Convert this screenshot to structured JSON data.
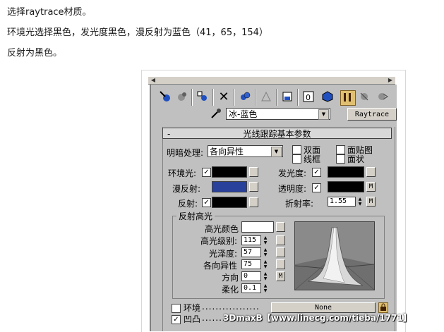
{
  "intro": {
    "line1": "选择raytrace材质。",
    "line2": "环境光选择黑色，发光度黑色，漫反射为蓝色（41，65，154）",
    "line3": "反射为黑色。"
  },
  "material": {
    "name": "冰-蓝色",
    "type_button": "Raytrace"
  },
  "rollout": {
    "toggle": "-",
    "title": "光线跟踪基本参数",
    "shading_label": "明暗处理:",
    "shading_value": "各向异性",
    "two_sided": "双面",
    "wire": "线框",
    "face_map": "面贴图",
    "faceted": "面状",
    "ambient_label": "环境光:",
    "ambient_checked": "✓",
    "diffuse_label": "漫反射:",
    "reflect_label": "反射:",
    "reflect_checked": "✓",
    "luminosity_label": "发光度:",
    "luminosity_checked": "✓",
    "transparency_label": "透明度:",
    "transparency_checked": "✓",
    "ior_label": "折射率:",
    "ior_value": "1.55",
    "map_button": "M",
    "colors": {
      "ambient": "#000000",
      "diffuse": "#29419a",
      "reflect": "#000000",
      "luminosity": "#000000",
      "transparency": "#000000",
      "specular": "#ffffff"
    }
  },
  "specular": {
    "group_title": "反射高光",
    "color_label": "高光颜色",
    "level_label": "高光级别:",
    "level_value": "115",
    "gloss_label": "光泽度:",
    "gloss_value": "57",
    "aniso_label": "各向异性",
    "aniso_value": "75",
    "orient_label": "方向",
    "orient_value": "0",
    "soften_label": "柔化",
    "soften_value": "0.1"
  },
  "extras": {
    "environment_label": "环境",
    "environment_dots": ".................",
    "bump_label": "凹凸",
    "bump_checked": "✓",
    "bump_dots": "..........",
    "none_button": "None",
    "watermark": "3DmaxB【www.linecg.com/tieba/1771】"
  },
  "icons": [
    "get-material-icon",
    "pick-material-icon",
    "put-to-scene-icon",
    "delete-icon",
    "show-map-icon",
    "make-unique-icon",
    "put-to-library-icon",
    "material-id-icon",
    "show-in-viewport-icon",
    "show-end-result-icon",
    "go-to-parent-icon",
    "go-forward-icon",
    "eyedropper-icon"
  ]
}
